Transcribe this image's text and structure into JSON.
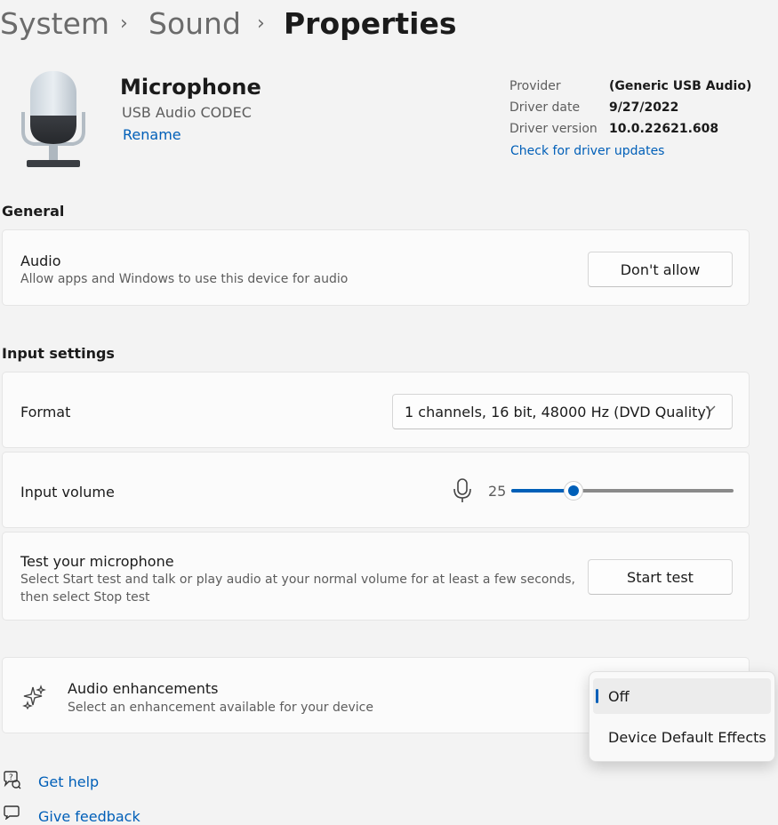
{
  "breadcrumb": {
    "items": [
      "System",
      "Sound",
      "Properties"
    ],
    "separator": "›"
  },
  "device": {
    "icon": "microphone-device-icon",
    "name": "Microphone",
    "subtitle": "USB Audio CODEC",
    "rename_label": "Rename"
  },
  "driver": {
    "provider_label": "Provider",
    "provider_value": "(Generic USB Audio)",
    "date_label": "Driver date",
    "date_value": "9/27/2022",
    "version_label": "Driver version",
    "version_value": "10.0.22621.608",
    "update_link": "Check for driver updates"
  },
  "general": {
    "heading": "General",
    "audio": {
      "title": "Audio",
      "description": "Allow apps and Windows to use this device for audio",
      "button_label": "Don't allow"
    }
  },
  "input_settings": {
    "heading": "Input settings",
    "format": {
      "title": "Format",
      "selected": "1 channels, 16 bit, 48000 Hz (DVD Quality)"
    },
    "input_volume": {
      "title": "Input volume",
      "value": "25",
      "level_percent": 25
    },
    "test": {
      "title": "Test your microphone",
      "description_line1": "Select Start test and talk or play audio at your normal volume for at least a few seconds,",
      "description_line2": "then select Stop test",
      "button_label": "Start test"
    }
  },
  "enhancements": {
    "icon": "sparkle-icon",
    "title": "Audio enhancements",
    "description": "Select an enhancement available for your device",
    "options": [
      "Off",
      "Device Default Effects"
    ],
    "selected": "Off"
  },
  "footer": {
    "help": "Get help",
    "feedback": "Give feedback"
  },
  "colors": {
    "accent": "#005fb8",
    "background": "#f3f3f3",
    "card": "#fbfbfb"
  }
}
